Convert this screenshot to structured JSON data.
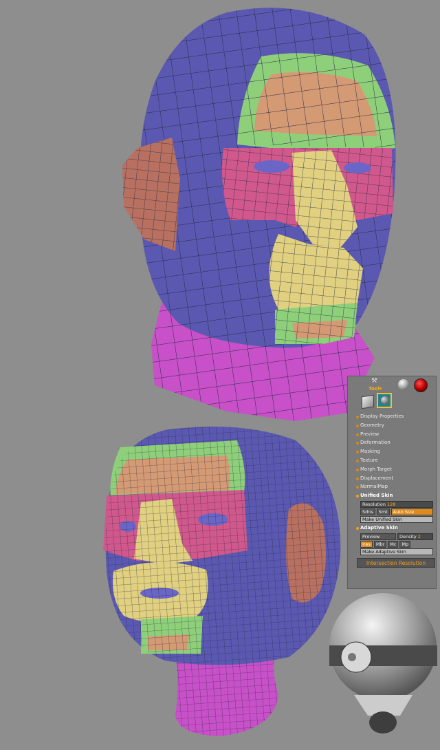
{
  "tool_palette": {
    "title": "Tool▾",
    "menu": [
      "Display Properties",
      "Geometry",
      "Preview",
      "Deformation",
      "Masking",
      "Texture",
      "Morph Target",
      "Displacement",
      "NormalMap"
    ],
    "unified_skin": {
      "header": "Unified Skin",
      "resolution_label": "Resolution",
      "resolution_value": "128",
      "sdns": "Sdns",
      "smt": "Smt",
      "auto_size": "Auto Size",
      "make_unified_skin": "Make Unified Skin"
    },
    "adaptive_skin": {
      "header": "Adaptive Skin",
      "preview": "Preview",
      "density_label": "Density",
      "density_value": "2",
      "ires": "Ires",
      "mbr": "Mbr",
      "mc": "Mc",
      "mp": "Mp",
      "make_adaptive_skin": "Make Adaptive Skin"
    },
    "tooltip": "Intersection Resolution"
  },
  "colors": {
    "background": "#8e8e8e",
    "blue_poly": "#5a58b0",
    "green_poly": "#8ed07a",
    "orange_poly": "#d49a74",
    "pink_poly": "#d0588c",
    "yellow_poly": "#e0d080",
    "magenta_poly": "#c850c8",
    "ear_poly": "#b87060",
    "accent": "#f0a020"
  }
}
